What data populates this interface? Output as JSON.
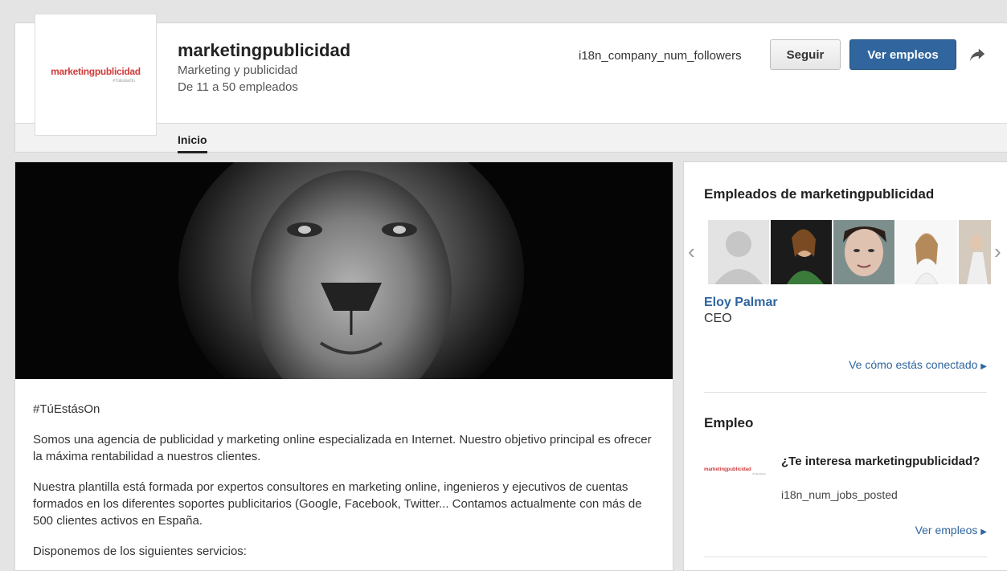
{
  "header": {
    "logo_text": "marketingpublicidad",
    "logo_tagline": "#TúEstásOn",
    "company_name": "marketingpublicidad",
    "industry": "Marketing y publicidad",
    "size": "De 11 a 50 empleados",
    "followers": "i18n_company_num_followers",
    "follow_label": "Seguir",
    "jobs_label": "Ver empleos",
    "share_icon": "share-arrow-icon"
  },
  "tabs": [
    {
      "label": "Inicio",
      "active": true
    }
  ],
  "about": {
    "tagline": "#TúEstásOn",
    "paragraph1": "Somos una agencia de publicidad y marketing online especializada en Internet. Nuestro objetivo principal es ofrecer la máxima rentabilidad a nuestros clientes.",
    "paragraph2": "Nuestra plantilla está formada por expertos consultores en marketing online, ingenieros y ejecutivos de cuentas formados en los diferentes soportes publicitarios (Google, Facebook, Twitter... Contamos actualmente con más de 500 clientes activos en España.",
    "paragraph3": "Disponemos de los siguientes servicios:"
  },
  "employees": {
    "title": "Empleados de marketingpublicidad",
    "prev_icon": "chevron-left-icon",
    "next_icon": "chevron-right-icon",
    "featured_name": "Eloy Palmar",
    "featured_role": "CEO",
    "connection_link": "Ve cómo estás conectado"
  },
  "jobs": {
    "title": "Empleo",
    "logo_text": "marketingpublicidad",
    "logo_tagline": "#TúEstásOn",
    "question": "¿Te interesa marketingpublicidad?",
    "posted": "i18n_num_jobs_posted",
    "link": "Ver empleos"
  },
  "colors": {
    "link_blue": "#30659d",
    "brand_red": "#d03a3a",
    "page_bg": "#e4e4e4"
  }
}
